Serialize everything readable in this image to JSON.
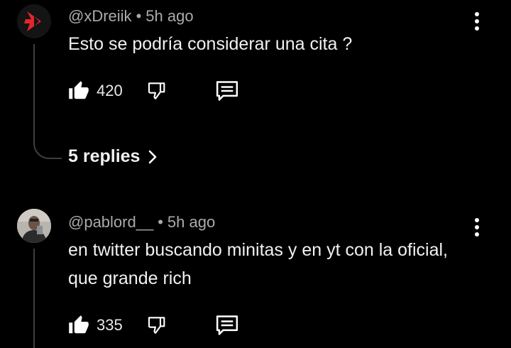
{
  "comments": [
    {
      "author": "@xDreiik",
      "separator": "•",
      "time": "5h ago",
      "text": "Esto se podría considerar una cita ?",
      "likes": "420",
      "replies_label": "5 replies",
      "avatar_icon": "red-arrow-logo",
      "accent": "#e3262e"
    },
    {
      "author": "@pablord__",
      "separator": "•",
      "time": "5h ago",
      "text": "en twitter buscando minitas y en yt con la oficial, que grande rich",
      "likes": "335",
      "avatar_icon": "person-photo"
    }
  ],
  "icons": {
    "like": "thumb-up-icon",
    "dislike": "thumb-down-icon",
    "reply": "comment-icon",
    "more": "more-vert-icon",
    "chevron": "chevron-right-icon"
  }
}
